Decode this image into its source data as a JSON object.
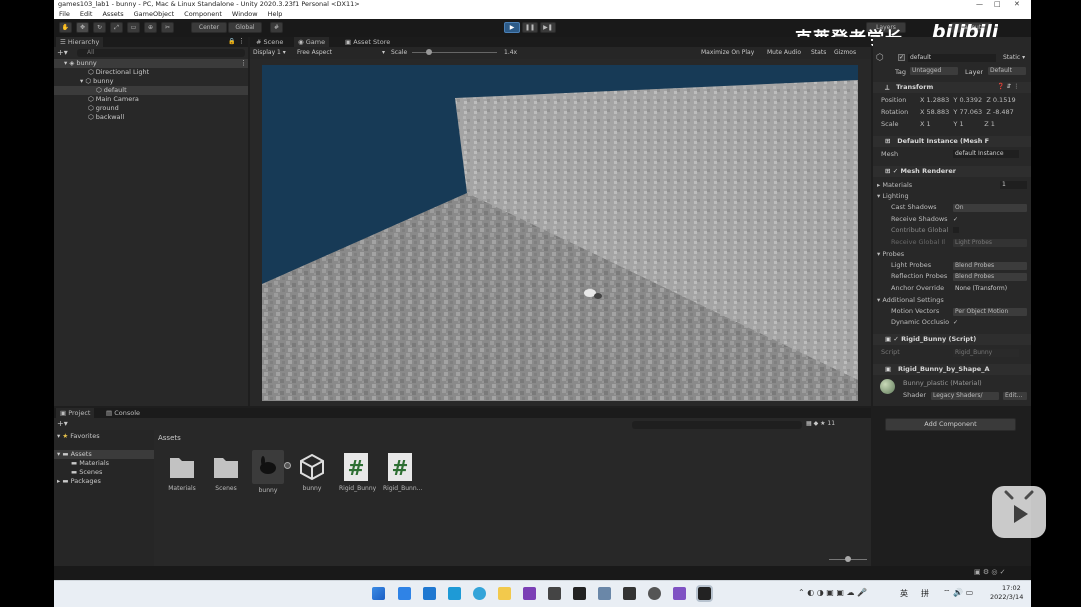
{
  "window": {
    "title": "games103_lab1 - bunny - PC, Mac & Linux Standalone - Unity 2020.3.23f1 Personal <DX11>"
  },
  "menu": [
    "File",
    "Edit",
    "Assets",
    "GameObject",
    "Component",
    "Window",
    "Help"
  ],
  "toolbar": {
    "pivot": "Center",
    "space": "Global",
    "layers": "Layers",
    "layout": "Layout"
  },
  "watermark": {
    "text": "克莱登老学长",
    "logo": "bilibili"
  },
  "hierarchy": {
    "tab": "Hierarchy",
    "search_placeholder": "All",
    "scene": "bunny",
    "items": [
      {
        "label": "Directional Light"
      },
      {
        "label": "bunny"
      },
      {
        "label": "default"
      },
      {
        "label": "Main Camera"
      },
      {
        "label": "ground"
      },
      {
        "label": "backwall"
      }
    ]
  },
  "game_view": {
    "tabs": [
      "Scene",
      "Game",
      "Asset Store"
    ],
    "display": "Display 1",
    "aspect": "Free Aspect",
    "scale_label": "Scale",
    "scale_value": "1.4x",
    "toggles": [
      "Maximize On Play",
      "Mute Audio",
      "Stats",
      "Gizmos"
    ]
  },
  "inspector": {
    "object_name": "default",
    "static_label": "Static",
    "tag_label": "Tag",
    "tag_value": "Untagged",
    "layer_label": "Layer",
    "layer_value": "Default",
    "transform": {
      "title": "Transform",
      "position_label": "Position",
      "pos": [
        "1.2883",
        "0.3392",
        "0.1519"
      ],
      "rotation_label": "Rotation",
      "rot": [
        "58.883",
        "77.063",
        "-8.487"
      ],
      "scale_label": "Scale",
      "scale": [
        "1",
        "1",
        "1"
      ]
    },
    "mesh_filter": {
      "title": "Default Instance (Mesh F",
      "mesh_label": "Mesh",
      "mesh_value": "default Instance"
    },
    "mesh_renderer": {
      "title": "Mesh Renderer",
      "materials_label": "Materials",
      "materials_count": "1",
      "lighting_label": "Lighting",
      "cast_shadows_label": "Cast Shadows",
      "cast_shadows_value": "On",
      "receive_shadows_label": "Receive Shadows",
      "contribute_gi_label": "Contribute Global",
      "receive_gi_label": "Receive Global Il",
      "receive_gi_value": "Light Probes",
      "probes_label": "Probes",
      "light_probes_label": "Light Probes",
      "light_probes_value": "Blend Probes",
      "reflection_probes_label": "Reflection Probes",
      "reflection_probes_value": "Blend Probes",
      "anchor_override_label": "Anchor Override",
      "anchor_override_value": "None (Transform)",
      "additional_label": "Additional Settings",
      "motion_vectors_label": "Motion Vectors",
      "motion_vectors_value": "Per Object Motion",
      "dynamic_occlusion_label": "Dynamic Occlusio"
    },
    "script1": {
      "title": "Rigid_Bunny (Script)",
      "script_label": "Script",
      "script_value": "Rigid_Bunny"
    },
    "script2": {
      "title": "Rigid_Bunny_by_Shape_A"
    },
    "material": {
      "title": "Bunny_plastic (Material)",
      "shader_label": "Shader",
      "shader_value": "Legacy Shaders/",
      "edit_label": "Edit..."
    },
    "add_component": "Add Component"
  },
  "project": {
    "tabs": [
      "Project",
      "Console"
    ],
    "favorites": "Favorites",
    "tree": [
      "Assets",
      "Materials",
      "Scenes",
      "Packages"
    ],
    "breadcrumb": "Assets",
    "count": "11",
    "assets": [
      {
        "label": "Materials",
        "kind": "folder"
      },
      {
        "label": "Scenes",
        "kind": "folder"
      },
      {
        "label": "bunny",
        "kind": "model"
      },
      {
        "label": "bunny",
        "kind": "unity"
      },
      {
        "label": "Rigid_Bunny",
        "kind": "script"
      },
      {
        "label": "Rigid_Bunn...",
        "kind": "script"
      }
    ]
  },
  "taskbar": {
    "ime1": "英",
    "ime2": "拼",
    "time": "17:02",
    "date": "2022/3/14"
  }
}
